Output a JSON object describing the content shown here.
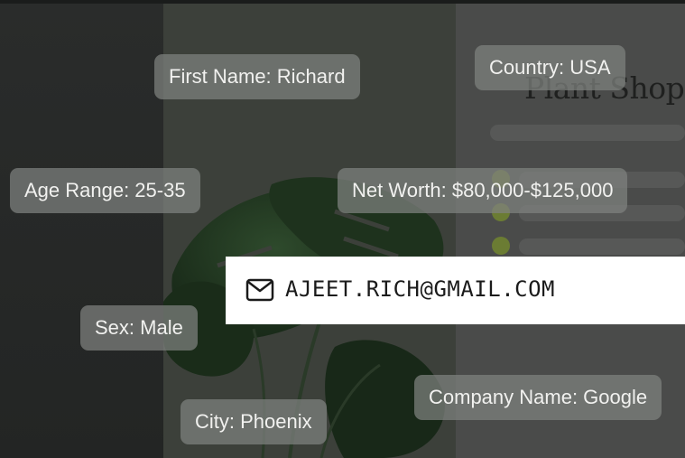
{
  "shop": {
    "title": "Plant Shop"
  },
  "email": {
    "address": "AJEET.RICH@GMAIL.COM",
    "icon": "mail-icon"
  },
  "profile_tags": {
    "first_name": "First Name: Richard",
    "country": "Country: USA",
    "age_range": "Age Range: 25-35",
    "net_worth": "Net Worth: $80,000-$125,000",
    "sex": "Sex: Male",
    "company_name": "Company Name: Google",
    "city": "City: Phoenix"
  },
  "colors": {
    "accent_green": "#6b7c33",
    "tag_bg": "#808280",
    "email_bg": "#ffffff"
  }
}
